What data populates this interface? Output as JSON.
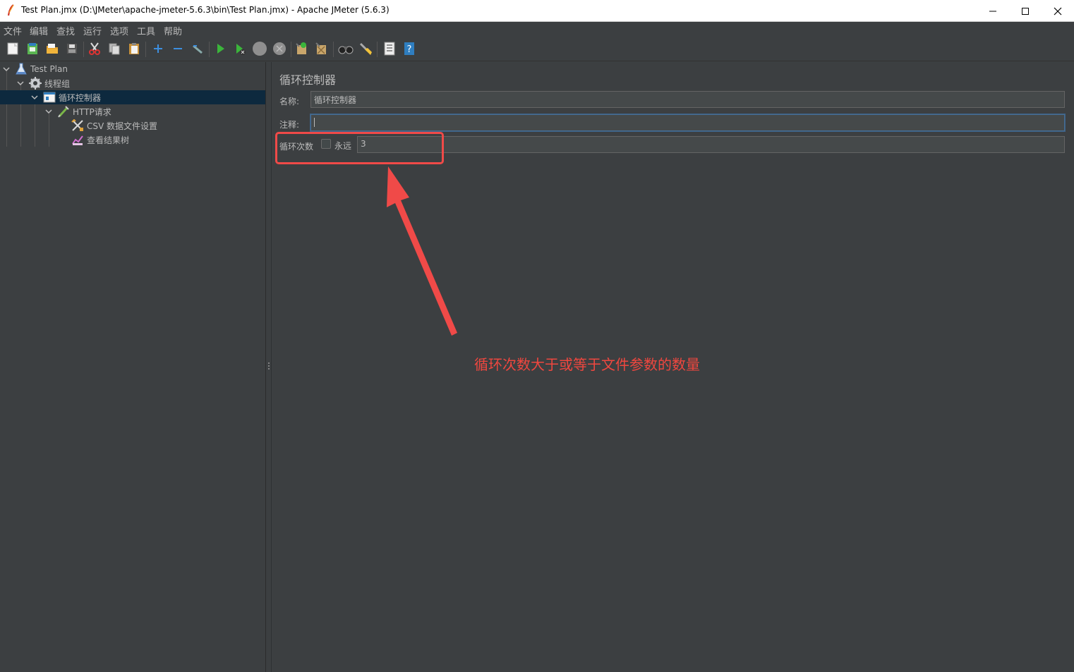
{
  "window": {
    "title": "Test Plan.jmx (D:\\JMeter\\apache-jmeter-5.6.3\\bin\\Test Plan.jmx) - Apache JMeter (5.6.3)",
    "controls": [
      "minimize-icon",
      "maximize-icon",
      "close-icon"
    ]
  },
  "menubar": {
    "items": [
      "文件",
      "编辑",
      "查找",
      "运行",
      "选项",
      "工具",
      "帮助"
    ]
  },
  "toolbar": {
    "buttons": [
      "new-icon",
      "templates-icon",
      "open-icon",
      "save-icon",
      "cut-icon",
      "copy-icon",
      "paste-icon",
      "expand-icon",
      "collapse-icon",
      "toggle-icon",
      "start-icon",
      "start-no-pauses-icon",
      "stop-icon",
      "shutdown-icon",
      "clear-icon",
      "clear-all-icon",
      "search-icon",
      "reset-search-icon",
      "function-helper-icon",
      "help-icon"
    ]
  },
  "tree": {
    "nodes": [
      {
        "label": "Test Plan",
        "icon": "test-plan-icon",
        "level": 0,
        "expanded": true
      },
      {
        "label": "线程组",
        "icon": "thread-group-icon",
        "level": 1,
        "expanded": true
      },
      {
        "label": "循环控制器",
        "icon": "loop-controller-icon",
        "level": 2,
        "expanded": true,
        "selected": true
      },
      {
        "label": "HTTP请求",
        "icon": "http-request-icon",
        "level": 3,
        "expanded": true
      },
      {
        "label": "CSV 数据文件设置",
        "icon": "csv-config-icon",
        "level": 4
      },
      {
        "label": "查看结果树",
        "icon": "results-tree-icon",
        "level": 4
      }
    ]
  },
  "panel": {
    "title": "循环控制器",
    "name_label": "名称:",
    "name_value": "循环控制器",
    "comment_label": "注释:",
    "comment_value": "",
    "loop_label": "循环次数",
    "forever_label": "永远",
    "forever_checked": false,
    "loop_count": "3"
  },
  "annotation": {
    "text": "循环次数大于或等于文件参数的数量",
    "color": "#f0473f"
  },
  "colors": {
    "background": "#3c3f41",
    "selection": "#0d293e",
    "text": "#bbbbbb",
    "accent_red": "#f04a48"
  }
}
